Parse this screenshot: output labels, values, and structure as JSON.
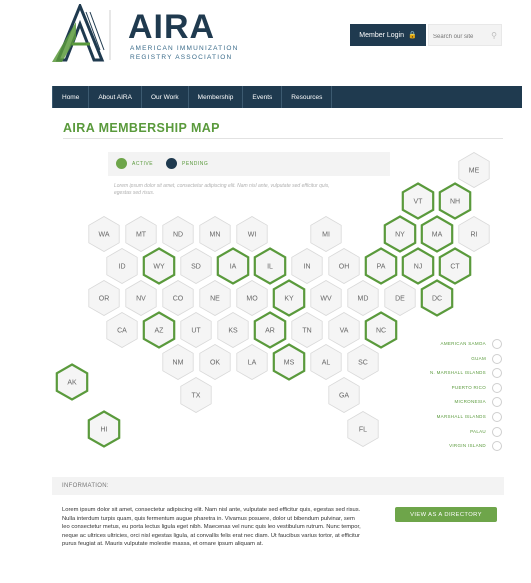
{
  "header": {
    "brand": "AIRA",
    "brand_subtitle": "AMERICAN IMMUNIZATION REGISTRY ASSOCIATION",
    "login_label": "Member Login",
    "search_placeholder": "Search our site"
  },
  "nav": {
    "items": [
      "Home",
      "About AIRA",
      "Our Work",
      "Membership",
      "Events",
      "Resources"
    ]
  },
  "page": {
    "title": "AIRA MEMBERSHIP MAP"
  },
  "legend": {
    "active_label": "ACTIVE",
    "pending_label": "PENDING",
    "note": "Lorem ipsum dolor sit amet, consectetur adipiscing elit. Nam nisl ante, vulputate sed efficitur quis, egestas sed risus."
  },
  "colors": {
    "active": "#5a9a3c",
    "pending": "#1f3a4f",
    "hex_fill": "#f5f5f5",
    "hex_border": "#d8d8d8"
  },
  "map": {
    "states": [
      {
        "code": "ME",
        "status": "none"
      },
      {
        "code": "VT",
        "status": "active"
      },
      {
        "code": "NH",
        "status": "active"
      },
      {
        "code": "WA",
        "status": "none"
      },
      {
        "code": "MT",
        "status": "none"
      },
      {
        "code": "ND",
        "status": "none"
      },
      {
        "code": "MN",
        "status": "none"
      },
      {
        "code": "WI",
        "status": "none"
      },
      {
        "code": "MI",
        "status": "none"
      },
      {
        "code": "NY",
        "status": "active"
      },
      {
        "code": "MA",
        "status": "active"
      },
      {
        "code": "RI",
        "status": "none"
      },
      {
        "code": "ID",
        "status": "none"
      },
      {
        "code": "WY",
        "status": "active"
      },
      {
        "code": "SD",
        "status": "none"
      },
      {
        "code": "IA",
        "status": "active"
      },
      {
        "code": "IL",
        "status": "active"
      },
      {
        "code": "IN",
        "status": "none"
      },
      {
        "code": "OH",
        "status": "none"
      },
      {
        "code": "PA",
        "status": "active"
      },
      {
        "code": "NJ",
        "status": "active"
      },
      {
        "code": "CT",
        "status": "active"
      },
      {
        "code": "OR",
        "status": "none"
      },
      {
        "code": "NV",
        "status": "none"
      },
      {
        "code": "CO",
        "status": "none"
      },
      {
        "code": "NE",
        "status": "none"
      },
      {
        "code": "MO",
        "status": "none"
      },
      {
        "code": "KY",
        "status": "active"
      },
      {
        "code": "WV",
        "status": "none"
      },
      {
        "code": "MD",
        "status": "none"
      },
      {
        "code": "DE",
        "status": "none"
      },
      {
        "code": "DC",
        "status": "active"
      },
      {
        "code": "CA",
        "status": "none"
      },
      {
        "code": "AZ",
        "status": "active"
      },
      {
        "code": "UT",
        "status": "none"
      },
      {
        "code": "KS",
        "status": "none"
      },
      {
        "code": "AR",
        "status": "active"
      },
      {
        "code": "TN",
        "status": "none"
      },
      {
        "code": "VA",
        "status": "none"
      },
      {
        "code": "NC",
        "status": "active"
      },
      {
        "code": "NM",
        "status": "none"
      },
      {
        "code": "OK",
        "status": "none"
      },
      {
        "code": "LA",
        "status": "none"
      },
      {
        "code": "MS",
        "status": "active"
      },
      {
        "code": "AL",
        "status": "none"
      },
      {
        "code": "SC",
        "status": "none"
      },
      {
        "code": "TX",
        "status": "none"
      },
      {
        "code": "GA",
        "status": "none"
      },
      {
        "code": "FL",
        "status": "none"
      },
      {
        "code": "AK",
        "status": "active"
      },
      {
        "code": "HI",
        "status": "active"
      }
    ],
    "territories": [
      "AMERICAN SAMOA",
      "GUAM",
      "N. MARSHALL ISLANDS",
      "PUERTO RICO",
      "MICRONESIA",
      "MARSHALL ISLANDS",
      "PALAU",
      "VIRGIN ISLAND"
    ]
  },
  "info": {
    "header": "INFORMATION:",
    "body": "Lorem ipsum dolor sit amet, consectetur adipiscing elit. Nam nisl ante, vulputate sed efficitur quis, egestas sed risus. Nulla interdum turpis quam, quis fermentum augue pharetra in. Vivamus posuere, dolor ut bibendum pulvinar, sem leo consectetur metus, eu porta lectus ligula eget nibh. Maecenas vel nunc quis leo vestibulum rutrum. Nunc tempor, neque ac ultrices ultricies, orci nisl egestas ligula, at convallis felis erat nec diam. Ut faucibus varius tortor, at efficitur purus feugiat at. Mauris vulputate molestie massa, et ornare ipsum aliquam at.",
    "directory_button": "VIEW AS A DIRECTORY"
  }
}
